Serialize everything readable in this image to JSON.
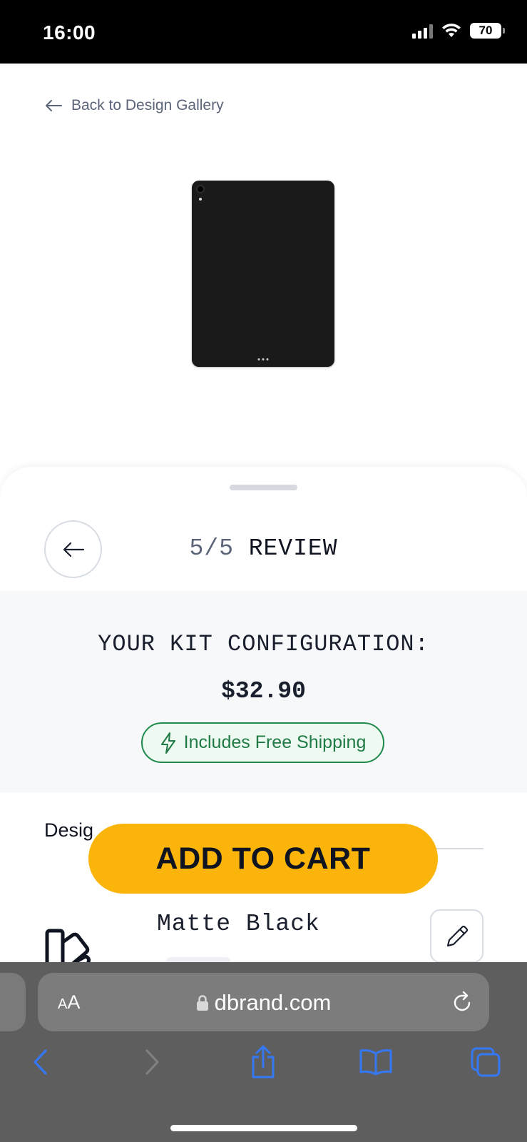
{
  "status_bar": {
    "time": "16:00",
    "battery": "70"
  },
  "nav": {
    "back_label": "Back to Design Gallery"
  },
  "step": {
    "count": "5/5",
    "name": "REVIEW"
  },
  "config": {
    "title": "YOUR KIT CONFIGURATION:",
    "price": "$32.90",
    "shipping": "Includes Free Shipping"
  },
  "design": {
    "label": "Desig",
    "option_name": "Matte Black"
  },
  "cta": {
    "add_to_cart": "ADD TO CART"
  },
  "browser": {
    "text_size_small": "A",
    "text_size_large": "A",
    "domain": "dbrand.com"
  },
  "colors": {
    "accent": "#FBB50A",
    "shipping_green": "#1F8A4C",
    "ios_blue": "#3478F6"
  },
  "icons": [
    "arrow-left-icon",
    "lightning-icon",
    "pencil-icon",
    "skin-layers-icon",
    "lock-icon",
    "reload-icon",
    "back-chevron-icon",
    "forward-chevron-icon",
    "share-icon",
    "bookmarks-icon",
    "tabs-icon"
  ]
}
